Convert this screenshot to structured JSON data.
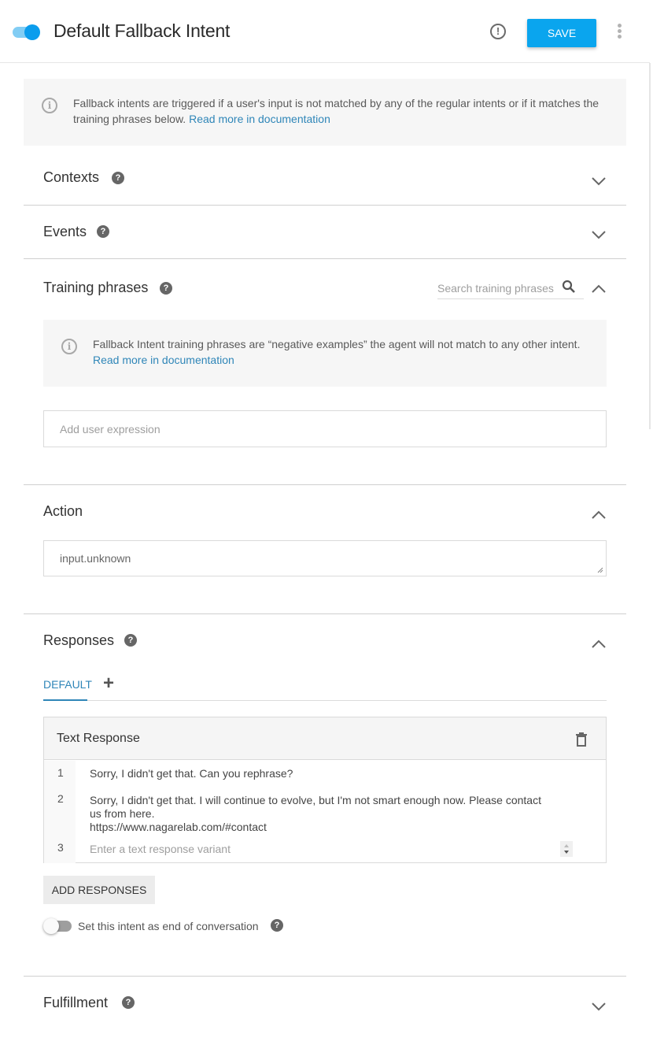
{
  "header": {
    "intent_enabled": true,
    "title": "Default Fallback Intent",
    "save_label": "SAVE",
    "alert_icon": "alert-circle-icon",
    "more_icon": "more-vert-icon"
  },
  "notice": {
    "text": "Fallback intents are triggered if a user's input is not matched by any of the regular intents or if it matches the training phrases below.",
    "link": "Read more in documentation"
  },
  "sections": {
    "contexts": {
      "title": "Contexts",
      "expanded": false
    },
    "events": {
      "title": "Events",
      "expanded": false
    },
    "training_phrases": {
      "title": "Training phrases",
      "expanded": true,
      "search_placeholder": "Search training phrases",
      "notice_text": "Fallback Intent training phrases are “negative examples” the agent will not match to any other intent.",
      "notice_link": "Read more in documentation",
      "input_placeholder": "Add user expression"
    },
    "action": {
      "title": "Action",
      "expanded": true,
      "value": "input.unknown"
    },
    "responses": {
      "title": "Responses",
      "expanded": true,
      "tabs": [
        {
          "label": "DEFAULT",
          "active": true
        }
      ],
      "add_tab_label": "+",
      "card_title": "Text Response",
      "lines": [
        {
          "num": "1",
          "text": "Sorry, I didn't get that. Can you rephrase?"
        },
        {
          "num": "2",
          "text": "Sorry, I didn't get that. I will continue to evolve, but I'm not smart enough now. Please contact us from here.",
          "text2": "https://www.nagarelab.com/#contact"
        },
        {
          "num": "3",
          "placeholder": "Enter a text response variant"
        }
      ],
      "add_button": "ADD RESPONSES",
      "end_conversation_label": "Set this intent as end of conversation",
      "end_conversation": false
    },
    "fulfillment": {
      "title": "Fulfillment",
      "expanded": false
    }
  },
  "colors": {
    "accent": "#0aa5ee",
    "link": "#2f86b8",
    "toggle_on": "#0b9ded"
  }
}
